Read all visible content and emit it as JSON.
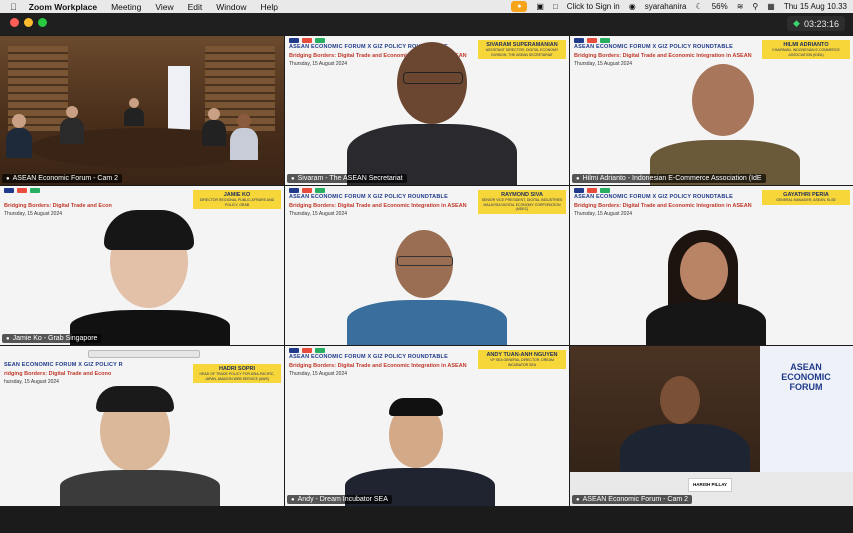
{
  "menubar": {
    "app_name": "Zoom Workplace",
    "menus": [
      "Meeting",
      "View",
      "Edit",
      "Window",
      "Help"
    ],
    "sign_in": "Click to Sign in",
    "user": "syarahanira",
    "battery": "56%",
    "datetime": "Thu 15 Aug  10.33"
  },
  "window": {
    "timer": "03:23:16"
  },
  "slide": {
    "forum_title": "ASEAN ECONOMIC FORUM X GIZ POLICY ROUNDTABLE",
    "subtitle": "Bridging Borders: Digital Trade and Economic Integration in ASEAN",
    "date": "Thursday, 15 August 2024"
  },
  "tiles": [
    {
      "label": "ASEAN Economic Forum - Cam 2"
    },
    {
      "label": "Sivaram - The ASEAN Secretariat",
      "card_name": "SIVARAM SUPERAMANIAN",
      "card_role": "ASSISTANT DIRECTOR, DIGITAL ECONOMY DIVISION, THE ASEAN SECRETARIAT"
    },
    {
      "label": "Hilmi Adrianto - Indonesian E-Commerce Association (IdE",
      "card_name": "HILMI ADRIANTO",
      "card_role": "CHAIRMAN, INDONESIAN E-COMMERCE ASSOCIATION (IDEA)"
    },
    {
      "label": "Jamie Ko - Grab Singapore",
      "card_name": "JAMIE KO",
      "card_role": "DIRECTOR REGIONAL PUBLIC AFFAIRS AND POLICY, GRAB",
      "subtitle_short": "Bridging Borders: Digital Trade and Econ"
    },
    {
      "card_name": "RAYMOND SIVA",
      "card_role": "SENIOR VICE PRESIDENT, DIGITAL INDUSTRIES MALAYSIA DIGITAL ECONOMY CORPORATION (MDEC)"
    },
    {
      "card_name": "GAYATHRI PERIA",
      "card_role": "GENERAL MANAGER, ASEAN, ELSE"
    },
    {
      "card_name": "HADRI SOPRI",
      "card_role": "HEAD OF TRADE POLICY FOR ASIA-PACIFIC, JAPAN, AMAZON WEB SERVICE (AWS)",
      "forum_short": "SEAN ECONOMIC FORUM X GIZ POLICY R",
      "subtitle_short": "ridging Borders: Digital Trade and Econo",
      "date_short": "hursday, 15 August 2024"
    },
    {
      "label": "Andy - Dream Incubator SEA",
      "card_name": "ANDY TUAN-ANH NGUYEN",
      "card_role": "VP SEA GENERAL DIRECTOR, DREAM INCUBATOR SEA"
    },
    {
      "label": "ASEAN Economic Forum - Cam 2",
      "logo_line1": "ASEAN",
      "logo_line2": "ECONOMIC",
      "logo_line3": "FORUM",
      "desk_name": "HARISH PILLAY"
    }
  ]
}
